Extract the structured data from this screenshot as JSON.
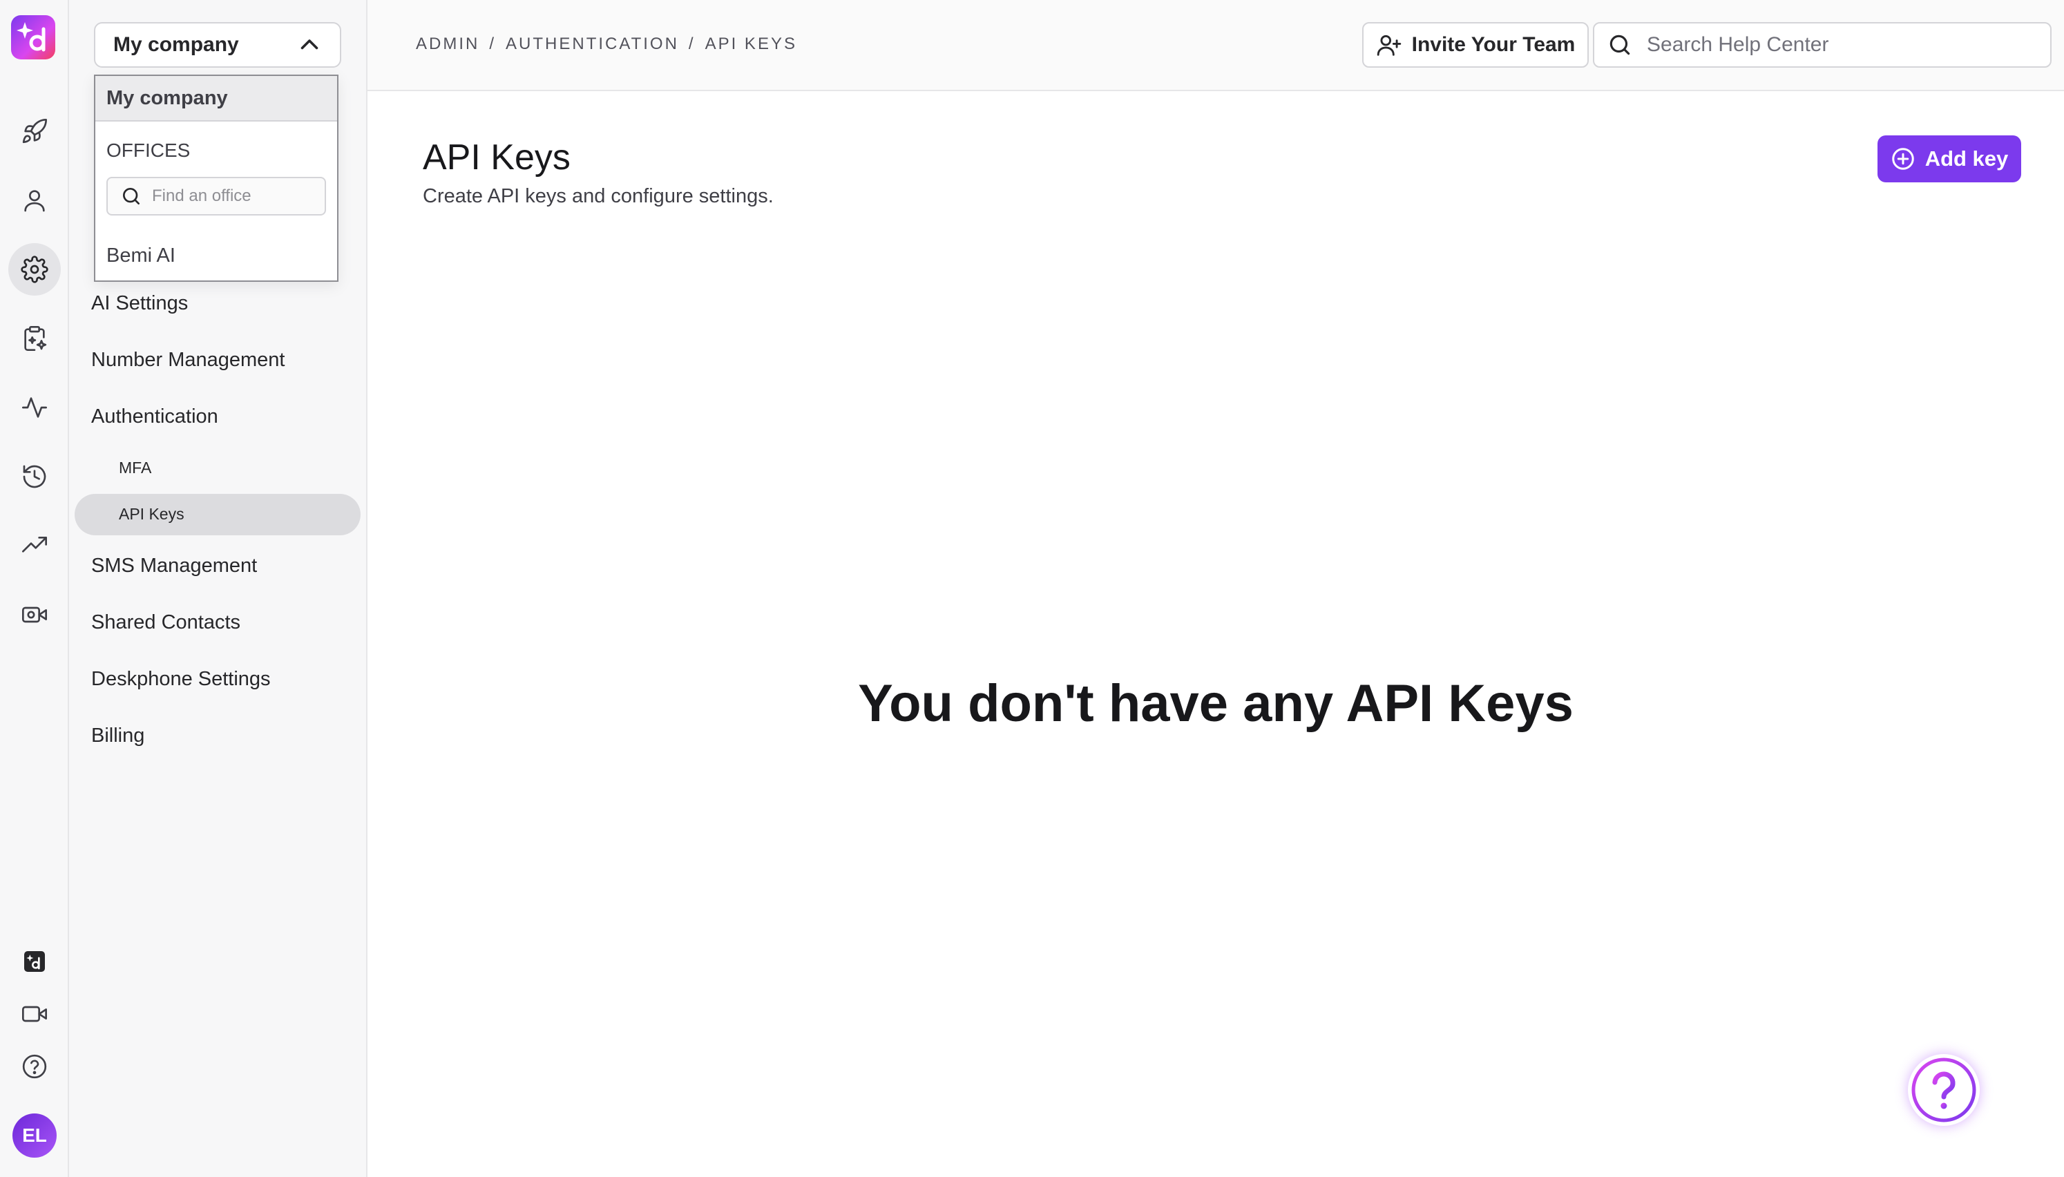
{
  "rail": {
    "avatar_initials": "EL"
  },
  "sidebar": {
    "company_select": "My company",
    "items": [
      {
        "label": "AI Settings"
      },
      {
        "label": "Number Management"
      },
      {
        "label": "Authentication"
      },
      {
        "label": "SMS Management"
      },
      {
        "label": "Shared Contacts"
      },
      {
        "label": "Deskphone Settings"
      },
      {
        "label": "Billing"
      }
    ],
    "sub_items": [
      {
        "label": "MFA"
      },
      {
        "label": "API Keys"
      }
    ]
  },
  "dropdown": {
    "selected": "My company",
    "section": "OFFICES",
    "search_placeholder": "Find an office",
    "options": [
      "Bemi AI"
    ]
  },
  "header": {
    "breadcrumb": [
      "ADMIN",
      "/",
      "AUTHENTICATION",
      "/",
      "API KEYS"
    ],
    "invite_label": "Invite Your Team",
    "search_placeholder": "Search Help Center"
  },
  "main": {
    "title": "API Keys",
    "subtitle": "Create API keys and configure settings.",
    "add_key_label": "Add key",
    "empty_state": "You don't have any API Keys"
  },
  "colors": {
    "accent": "#7c3aed",
    "rail_bg": "#f7f7f8",
    "active_bg": "#dcdcdf"
  }
}
